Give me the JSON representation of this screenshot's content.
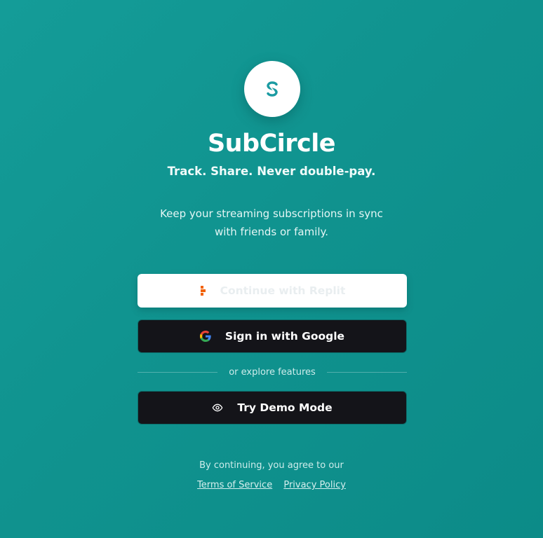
{
  "brand": {
    "name": "SubCircle",
    "tagline": "Track. Share. Never double-pay.",
    "description": "Keep your streaming subscriptions in sync with friends or family.",
    "logo_icon": "subcircle-s-logo",
    "accent_color": "#1a9aa0"
  },
  "auth": {
    "replit_label": "Continue with Replit",
    "replit_icon": "replit-icon",
    "replit_color": "#f26207",
    "google_label": "Sign in with Google",
    "google_icon": "google-g-icon",
    "divider_text": "or explore features",
    "demo_label": "Try Demo Mode",
    "demo_icon": "eye-icon"
  },
  "legal": {
    "notice": "By continuing, you agree to our",
    "terms_label": "Terms of Service",
    "privacy_label": "Privacy Policy"
  },
  "colors": {
    "background": "#11968f",
    "dark_button": "#141419",
    "light_button": "#ffffff"
  }
}
